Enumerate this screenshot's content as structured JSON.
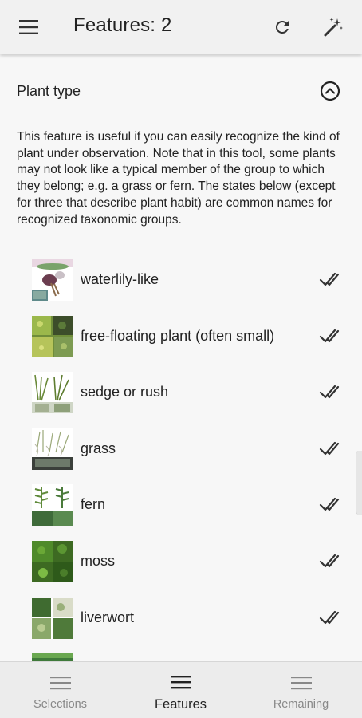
{
  "appbar": {
    "title": "Features: 2",
    "icons": [
      "menu-icon",
      "refresh-icon",
      "magic-wand-icon"
    ]
  },
  "section": {
    "title": "Plant type",
    "icon": "chevron-up-circle-icon",
    "description": "This feature is useful if you can easily recognize the kind of plant under observation. Note that in this tool, some plants may not look like a typical member of the group to which they belong; e.g. a grass or fern. The states below (except for three that describe plant habit) are common names for recognized taxonomic groups."
  },
  "states": [
    {
      "label": "waterlily-like",
      "checked": true
    },
    {
      "label": "free-floating plant (often small)",
      "checked": true
    },
    {
      "label": "sedge or rush",
      "checked": true
    },
    {
      "label": "grass",
      "checked": true
    },
    {
      "label": "fern",
      "checked": true
    },
    {
      "label": "moss",
      "checked": true
    },
    {
      "label": "liverwort",
      "checked": true
    }
  ],
  "bottom_nav": {
    "tabs": [
      {
        "label": "Selections",
        "active": false
      },
      {
        "label": "Features",
        "active": true
      },
      {
        "label": "Remaining",
        "active": false
      }
    ]
  },
  "colors": {
    "appbar_bg": "#f1f1f1",
    "page_bg": "#f7f7f7",
    "bottomnav_bg": "#ececec",
    "inactive_tab_text": "#888888",
    "active_tab_text": "#222222"
  }
}
